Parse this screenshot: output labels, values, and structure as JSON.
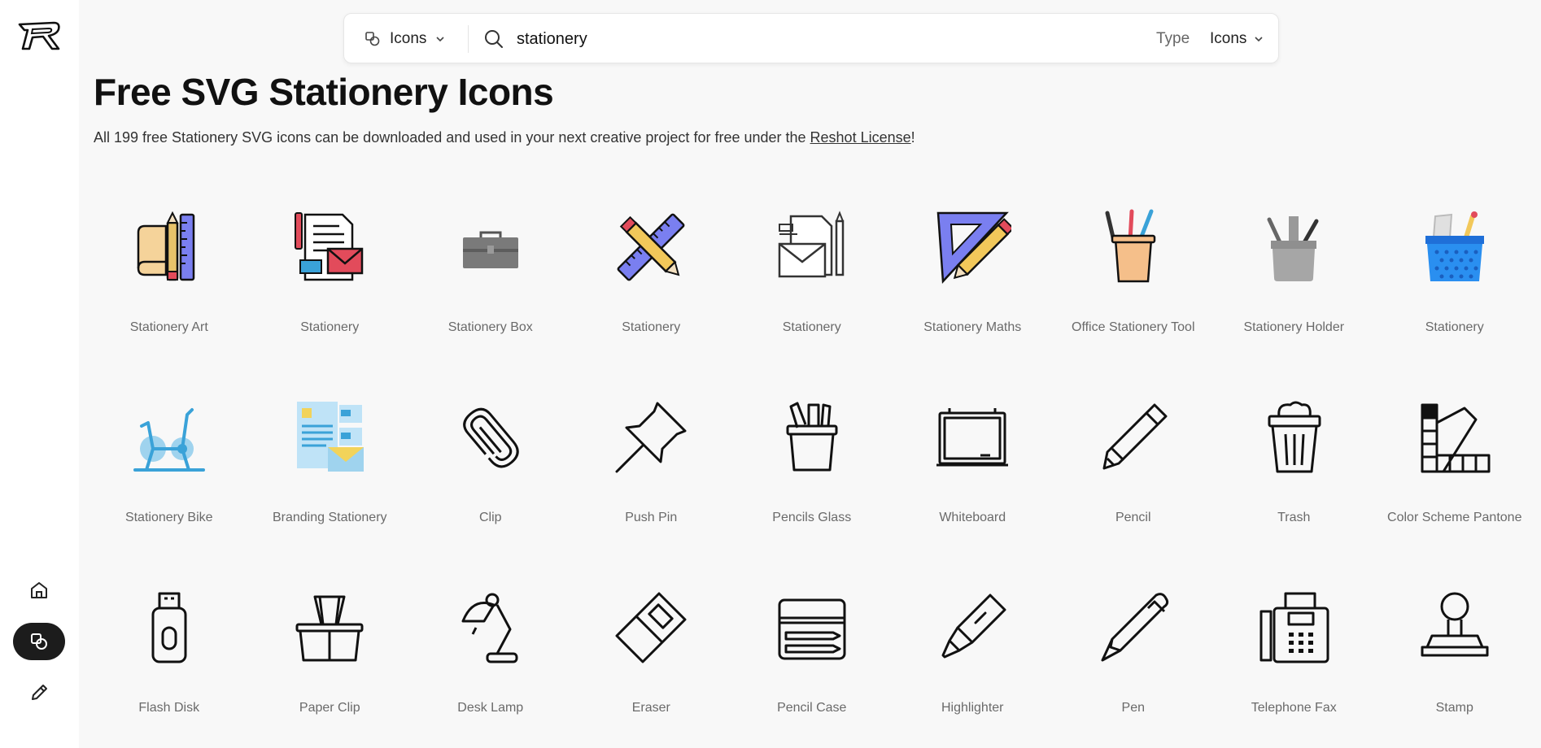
{
  "search": {
    "filter_label": "Icons",
    "query": "stationery",
    "type_label": "Type",
    "type_value": "Icons"
  },
  "header": {
    "title": "Free SVG Stationery Icons",
    "desc_prefix": "All 199 free Stationery SVG icons can be downloaded and used in your next creative project for free under the ",
    "license_link": "Reshot License",
    "desc_suffix": "!"
  },
  "icons": [
    {
      "label": "Stationery Art",
      "icon": "stationery-art"
    },
    {
      "label": "Stationery",
      "icon": "stationery-documents-mail"
    },
    {
      "label": "Stationery Box",
      "icon": "toolbox"
    },
    {
      "label": "Stationery",
      "icon": "pencil-ruler-cross"
    },
    {
      "label": "Stationery",
      "icon": "envelope-pencil"
    },
    {
      "label": "Stationery Maths",
      "icon": "set-square-pencil"
    },
    {
      "label": "Office Stationery Tool",
      "icon": "pen-cup"
    },
    {
      "label": "Stationery Holder",
      "icon": "grey-pen-holder"
    },
    {
      "label": "Stationery",
      "icon": "blue-mesh-holder"
    },
    {
      "label": "Stationery Bike",
      "icon": "exercise-bike"
    },
    {
      "label": "Branding Stationery",
      "icon": "branding-docs"
    },
    {
      "label": "Clip",
      "icon": "paperclip"
    },
    {
      "label": "Push Pin",
      "icon": "push-pin"
    },
    {
      "label": "Pencils Glass",
      "icon": "pencils-glass"
    },
    {
      "label": "Whiteboard",
      "icon": "whiteboard"
    },
    {
      "label": "Pencil",
      "icon": "pencil"
    },
    {
      "label": "Trash",
      "icon": "trash"
    },
    {
      "label": "Color Scheme Pantone",
      "icon": "pantone"
    },
    {
      "label": "Flash Disk",
      "icon": "flash-disk"
    },
    {
      "label": "Paper Clip",
      "icon": "binder-clip"
    },
    {
      "label": "Desk Lamp",
      "icon": "desk-lamp"
    },
    {
      "label": "Eraser",
      "icon": "eraser"
    },
    {
      "label": "Pencil Case",
      "icon": "pencil-case"
    },
    {
      "label": "Highlighter",
      "icon": "highlighter"
    },
    {
      "label": "Pen",
      "icon": "pen"
    },
    {
      "label": "Telephone Fax",
      "icon": "telephone-fax"
    },
    {
      "label": "Stamp",
      "icon": "stamp"
    }
  ],
  "sidebar": {
    "items": [
      {
        "name": "home",
        "icon": "home-icon"
      },
      {
        "name": "icons",
        "icon": "shapes-icon",
        "active": true
      },
      {
        "name": "illustrations",
        "icon": "pencil-icon"
      }
    ]
  },
  "colors": {
    "background": "#f8f8f8",
    "sidebar": "#ffffff",
    "active_nav": "#1c1c1c",
    "label_text": "#6a6a6a"
  }
}
